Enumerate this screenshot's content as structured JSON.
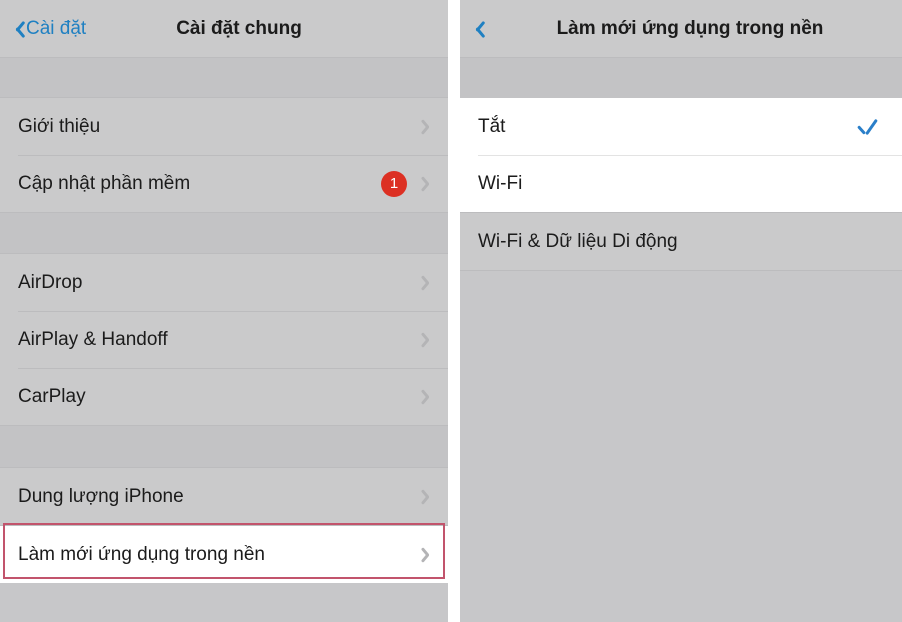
{
  "left_screen": {
    "nav": {
      "back_label": "Cài đặt",
      "back_icon": "chevron-left-icon",
      "title": "Cài đặt chung"
    },
    "groups": [
      {
        "rows": [
          {
            "label": "Giới thiệu",
            "accessory": "chevron-right-icon"
          },
          {
            "label": "Cập nhật phần mềm",
            "badge": "1",
            "accessory": "chevron-right-icon"
          }
        ]
      },
      {
        "rows": [
          {
            "label": "AirDrop",
            "accessory": "chevron-right-icon"
          },
          {
            "label": "AirPlay & Handoff",
            "accessory": "chevron-right-icon"
          },
          {
            "label": "CarPlay",
            "accessory": "chevron-right-icon"
          }
        ]
      },
      {
        "rows": [
          {
            "label": "Dung lượng iPhone",
            "accessory": "chevron-right-icon"
          }
        ]
      },
      {
        "highlighted": true,
        "rows": [
          {
            "label": "Làm mới ứng dụng trong nền",
            "accessory": "chevron-right-icon"
          }
        ]
      }
    ]
  },
  "right_screen": {
    "nav": {
      "back_icon": "chevron-left-icon",
      "title": "Làm mới ứng dụng trong nền"
    },
    "options": {
      "selected": "Tắt",
      "rows": [
        {
          "label": "Tắt",
          "checked": true
        },
        {
          "label": "Wi-Fi",
          "checked": false
        }
      ],
      "extra_rows": [
        {
          "label": "Wi-Fi & Dữ liệu Di động",
          "checked": false
        }
      ]
    }
  },
  "annotations": {
    "highlight_color": "#c2546c",
    "left_highlight_target": "Làm mới ứng dụng trong nền",
    "right_highlight_target": "Tắt / Wi-Fi"
  },
  "colors": {
    "accent_blue": "#1f80c2",
    "badge_red": "#dc3023",
    "panel_bg": "#c7c7c9",
    "row_bg": "#cacacb"
  }
}
